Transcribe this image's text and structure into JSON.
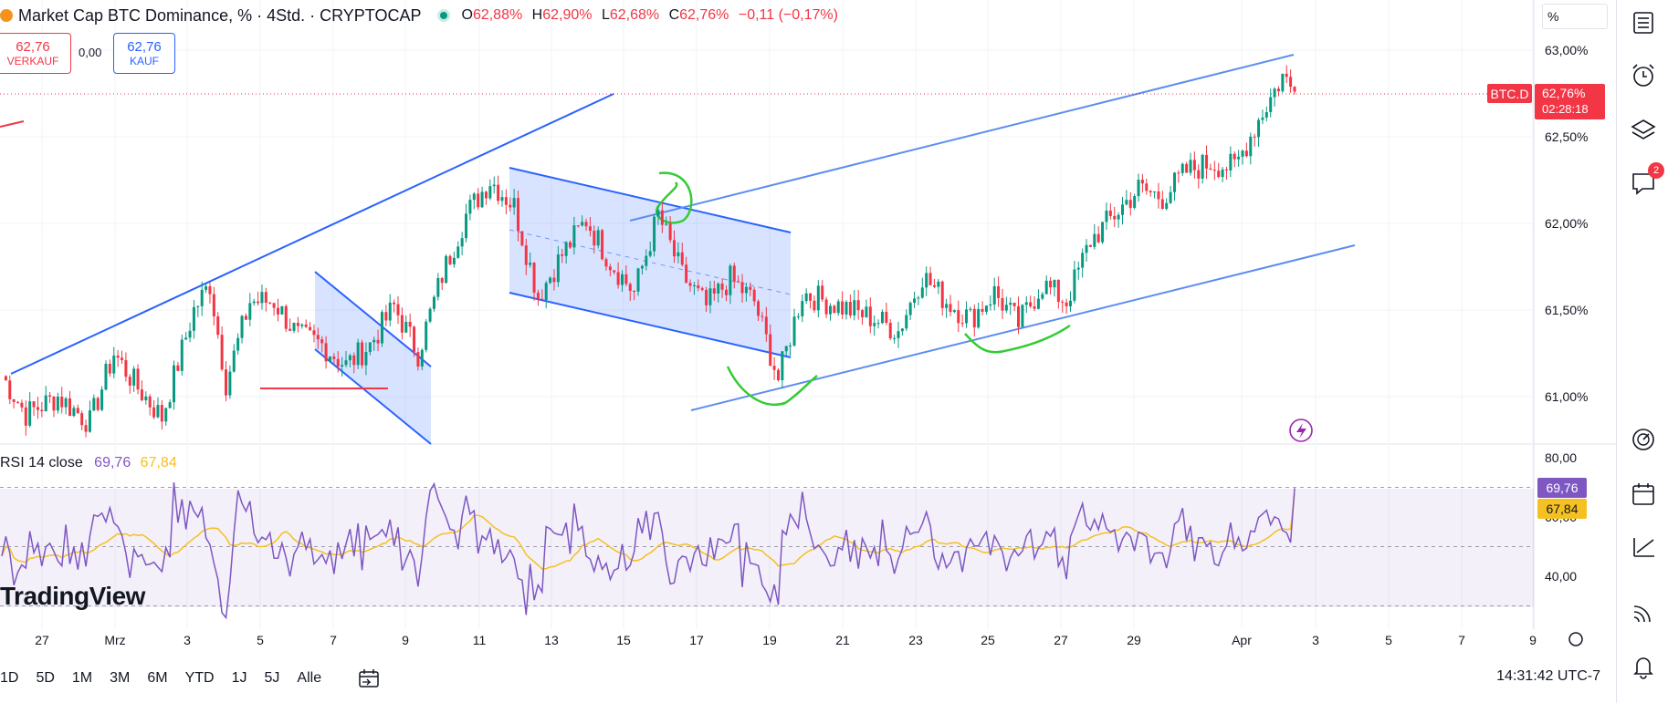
{
  "header": {
    "title": "Market Cap BTC Dominance, % · 4Std. · CRYPTOCAP",
    "ohlc": [
      {
        "k": "O",
        "v": "62,88%"
      },
      {
        "k": "H",
        "v": "62,90%"
      },
      {
        "k": "L",
        "v": "62,68%"
      },
      {
        "k": "C",
        "v": "62,76%"
      }
    ],
    "change": "−0,11 (−0,17%)",
    "sell_price": "62,76",
    "sell_label": "VERKAUF",
    "spread": "0,00",
    "buy_price": "62,76",
    "buy_label": "KAUF"
  },
  "scale_unit": "%",
  "price_tag": {
    "symbol": "BTC.D",
    "price": "62,76%",
    "countdown": "02:28:18"
  },
  "rsi": {
    "label": "RSI 14 close",
    "value": "69,76",
    "ma_value": "67,84"
  },
  "logo": "TradingView",
  "ranges": [
    "1D",
    "5D",
    "1M",
    "3M",
    "6M",
    "YTD",
    "1J",
    "5J",
    "Alle"
  ],
  "clock": "14:31:42 UTC-7",
  "sidebar": {
    "notification_count": "2"
  },
  "colors": {
    "up": "#089981",
    "down": "#f23645",
    "trendline": "#2962ff",
    "rsi": "#7e57c2",
    "rsi_ma": "#f5c021"
  },
  "chart_data": [
    {
      "type": "candlestick",
      "title": "Market Cap BTC Dominance, % · 4Std. · CRYPTOCAP",
      "x_ticks": [
        "27",
        "Mrz",
        "3",
        "5",
        "7",
        "9",
        "11",
        "13",
        "15",
        "17",
        "19",
        "21",
        "23",
        "25",
        "27",
        "29",
        "Apr",
        "3",
        "5",
        "7",
        "9"
      ],
      "y_ticks": [
        "63,00%",
        "62,50%",
        "62,00%",
        "61,50%",
        "61,00%"
      ],
      "ylim": [
        60.73,
        63.2
      ],
      "n_candles": 210,
      "anchors": [
        [
          0,
          61.12
        ],
        [
          6,
          60.9
        ],
        [
          14,
          61.0
        ],
        [
          22,
          60.85
        ],
        [
          28,
          61.25
        ],
        [
          34,
          61.05
        ],
        [
          40,
          60.88
        ],
        [
          48,
          61.5
        ],
        [
          52,
          61.65
        ],
        [
          56,
          61.08
        ],
        [
          62,
          61.55
        ],
        [
          68,
          61.55
        ],
        [
          74,
          61.35
        ],
        [
          80,
          61.3
        ],
        [
          86,
          61.18
        ],
        [
          92,
          61.3
        ],
        [
          98,
          61.52
        ],
        [
          104,
          61.25
        ],
        [
          110,
          61.7
        ],
        [
          116,
          62.05
        ],
        [
          122,
          62.25
        ],
        [
          128,
          62.1
        ],
        [
          134,
          61.58
        ],
        [
          140,
          61.82
        ],
        [
          146,
          62.02
        ],
        [
          152,
          61.78
        ],
        [
          158,
          61.6
        ],
        [
          164,
          62.05
        ],
        [
          170,
          61.7
        ],
        [
          176,
          61.52
        ],
        [
          182,
          61.68
        ],
        [
          188,
          61.55
        ],
        [
          194,
          61.1
        ],
        [
          200,
          61.6
        ],
        [
          206,
          61.55
        ],
        [
          212,
          61.5
        ],
        [
          218,
          61.45
        ],
        [
          224,
          61.38
        ],
        [
          230,
          61.7
        ],
        [
          236,
          61.55
        ],
        [
          242,
          61.45
        ],
        [
          248,
          61.6
        ],
        [
          254,
          61.42
        ],
        [
          260,
          61.65
        ],
        [
          266,
          61.55
        ],
        [
          272,
          61.9
        ],
        [
          278,
          62.05
        ],
        [
          284,
          62.2
        ],
        [
          290,
          62.15
        ],
        [
          296,
          62.3
        ],
        [
          302,
          62.35
        ],
        [
          308,
          62.32
        ],
        [
          314,
          62.6
        ],
        [
          320,
          62.85
        ],
        [
          323,
          62.76
        ]
      ],
      "annotations": [
        "ascending channel",
        "descending channel",
        "bull flag"
      ]
    },
    {
      "type": "line",
      "title": "RSI 14 close",
      "y_ticks": [
        "80,00",
        "60,00",
        "40,00"
      ],
      "ylim": [
        24,
        82
      ],
      "series": [
        {
          "name": "RSI 14 close",
          "last": 69.76
        },
        {
          "name": "MA",
          "last": 67.84
        }
      ]
    }
  ]
}
